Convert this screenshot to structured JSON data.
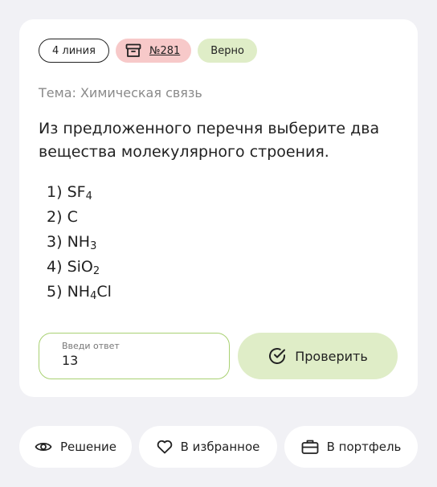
{
  "task": {
    "line_badge": "4 линия",
    "number": "№281",
    "status": "Верно",
    "topic": "Тема: Химическая связь",
    "question": "Из предложенного перечня выберите два вещества молекулярного строения.",
    "options": [
      {
        "n": "1)",
        "formula": "SF",
        "sub": "4",
        "rest": ""
      },
      {
        "n": "2)",
        "formula": "C",
        "sub": "",
        "rest": ""
      },
      {
        "n": "3)",
        "formula": "NH",
        "sub": "3",
        "rest": ""
      },
      {
        "n": "4)",
        "formula": "SiO",
        "sub": "2",
        "rest": ""
      },
      {
        "n": "5)",
        "formula": "NH",
        "sub": "4",
        "rest": "Cl"
      }
    ]
  },
  "answer": {
    "label": "Введи ответ",
    "value": "13"
  },
  "check_button": "Проверить",
  "bottom_actions": {
    "solution": "Решение",
    "favorite": "В избранное",
    "portfolio": "В портфель"
  },
  "colors": {
    "background": "#f1f1f5",
    "card": "#ffffff",
    "number_badge": "#f7c9c9",
    "success": "#dfedc7",
    "answer_border": "#a9d173"
  },
  "icons": {
    "number_badge": "archive-box-icon",
    "check_button": "check-circle-icon",
    "solution": "eye-icon",
    "favorite": "heart-icon",
    "portfolio": "briefcase-icon"
  }
}
